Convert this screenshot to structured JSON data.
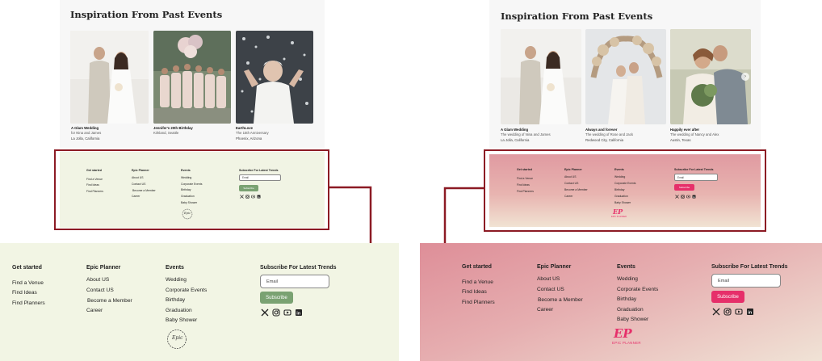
{
  "left": {
    "title": "Inspiration From Past Events",
    "cards": [
      {
        "title": "A Glam Wedding",
        "sub": "for Nina and James",
        "loc": "La Jolla, California"
      },
      {
        "title": "Jennifer's 20th Birthday",
        "sub": "Kirkland, Seattle",
        "loc": ""
      },
      {
        "title": "EarthLove",
        "sub": "The 15th Anniversary",
        "loc": "Phoenix, Arizona"
      }
    ]
  },
  "right": {
    "title": "Inspiration From Past Events",
    "cards": [
      {
        "title": "A Glam Wedding",
        "sub": "The wedding of Nina and James",
        "loc": "La Jolla, California"
      },
      {
        "title": "Always and forever",
        "sub": "The wedding of Rose and Jack",
        "loc": "Redwood City, California"
      },
      {
        "title": "Happily ever after",
        "sub": "The wedding of Nancy and Alex",
        "loc": "Austin, Texas"
      }
    ]
  },
  "footer": {
    "col1": {
      "title": "Get started",
      "items": [
        "Find a Venue",
        "Find Ideas",
        "Find Planners"
      ]
    },
    "col2": {
      "title": "Epic Planner",
      "items": [
        "About US",
        "Contact US",
        "Become a Member",
        "Career"
      ]
    },
    "col3": {
      "title": "Events",
      "items": [
        "Wedding",
        "Corporate Events",
        "Birthday",
        "Graduation",
        "Baby Shower"
      ]
    },
    "subscribe": {
      "title": "Subscribe For Latest Trends",
      "placeholder": "Email",
      "button": "Subscribe"
    },
    "logo_green": "Epic",
    "logo_pink_mark": "EP",
    "logo_pink_text": "EPIC PLANNER"
  },
  "colors": {
    "accent_green": "#7aa272",
    "accent_pink": "#e62f6a",
    "highlight": "#8c1a24"
  }
}
